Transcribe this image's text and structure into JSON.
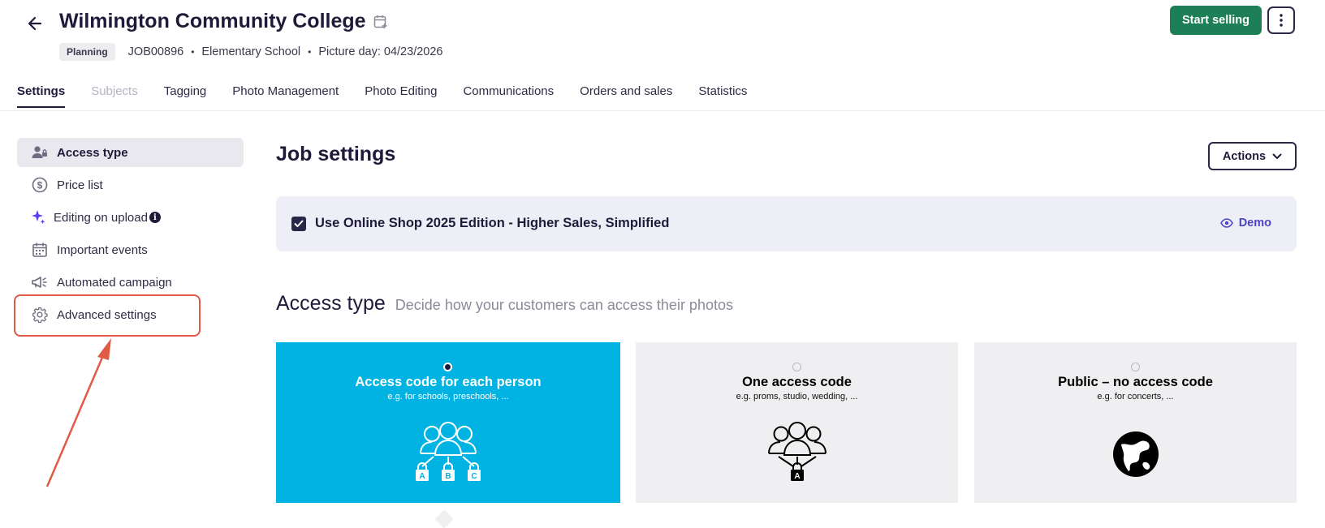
{
  "header": {
    "back_icon": "arrow-left-icon",
    "title": "Wilmington Community College",
    "calendar_icon": "calendar-plus-icon",
    "status": "Planning",
    "job_id": "JOB00896",
    "separator": "•",
    "school_type": "Elementary School",
    "picture_day": "Picture day: 04/23/2026",
    "start_selling_label": "Start selling",
    "more_icon": "vertical-dots-icon"
  },
  "tabs": [
    {
      "label": "Settings",
      "active": true
    },
    {
      "label": "Subjects",
      "disabled": true
    },
    {
      "label": "Tagging"
    },
    {
      "label": "Photo Management"
    },
    {
      "label": "Photo Editing"
    },
    {
      "label": "Communications"
    },
    {
      "label": "Orders and sales"
    },
    {
      "label": "Statistics"
    }
  ],
  "sidebar": {
    "items": [
      {
        "label": "Access type",
        "icon": "user-lock-icon",
        "active": true
      },
      {
        "label": "Price list",
        "icon": "dollar-circle-icon"
      },
      {
        "label": "Editing on upload",
        "icon": "sparkle-icon",
        "info_icon": "info-icon"
      },
      {
        "label": "Important events",
        "icon": "calendar-icon"
      },
      {
        "label": "Automated campaign",
        "icon": "megaphone-icon"
      },
      {
        "label": "Advanced settings",
        "icon": "gear-icon"
      }
    ]
  },
  "main": {
    "title": "Job settings",
    "actions_label": "Actions",
    "banner": {
      "checked": true,
      "label": "Use Online Shop 2025 Edition - Higher Sales, Simplified",
      "demo_label": "Demo",
      "demo_icon": "eye-icon"
    },
    "access": {
      "title": "Access type",
      "subtitle": "Decide how your customers can access their photos",
      "options": [
        {
          "title": "Access code for each person",
          "subtitle": "e.g. for schools, preschools, ...",
          "selected": true,
          "icon": "group-locks-icon",
          "lock_letters": [
            "A",
            "B",
            "C"
          ]
        },
        {
          "title": "One access code",
          "subtitle": "e.g. proms, studio, wedding, ...",
          "selected": false,
          "icon": "group-single-lock-icon",
          "lock_letter": "A"
        },
        {
          "title": "Public – no access code",
          "subtitle": "e.g. for concerts, ...",
          "selected": false,
          "icon": "globe-icon"
        }
      ]
    }
  },
  "colors": {
    "accent_green": "#1d7f56",
    "selected_card": "#00b3e3",
    "highlight": "#e05a44",
    "link": "#4a45c8"
  }
}
